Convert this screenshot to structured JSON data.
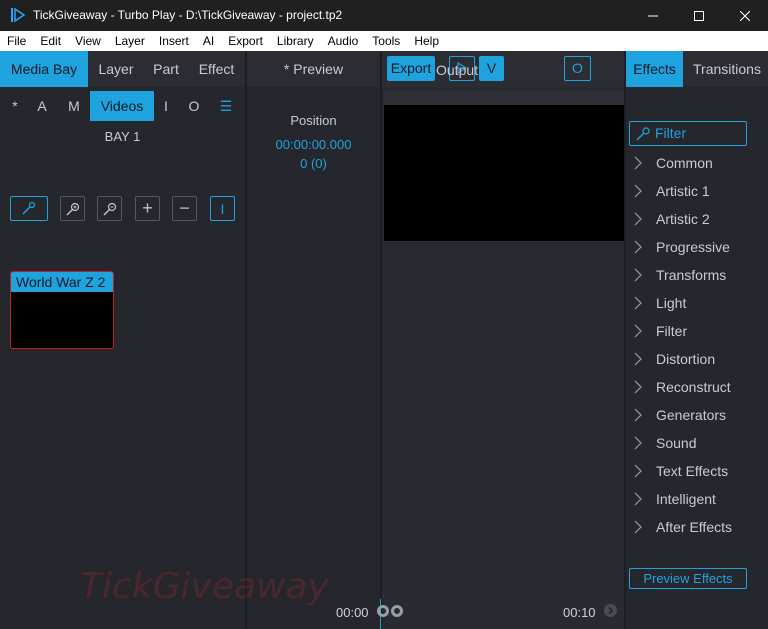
{
  "window": {
    "title": "TickGiveaway - Turbo Play - D:\\TickGiveaway - project.tp2"
  },
  "menu": [
    "File",
    "Edit",
    "View",
    "Layer",
    "Insert",
    "AI",
    "Export",
    "Library",
    "Audio",
    "Tools",
    "Help"
  ],
  "left_panel": {
    "tabs": [
      "Media Bay",
      "Layer",
      "Part",
      "Effect"
    ],
    "active_tab": "Media Bay",
    "subtabs": [
      "*",
      "A",
      "M",
      "Videos",
      "I",
      "O",
      "☰"
    ],
    "active_subtab": "Videos",
    "bay_label": "BAY 1",
    "clips": [
      {
        "title": "World War Z 2"
      }
    ],
    "tools": [
      "zoom-in-tool",
      "zoom-plus-tool",
      "zoom-minus-tool",
      "+",
      "−",
      "I"
    ]
  },
  "preview_panel": {
    "tab_label": "*  Preview",
    "position_label": "Position",
    "position_time": "00:00:00.000",
    "position_frame": "0 (0)"
  },
  "output_panel": {
    "export_label": "Export",
    "output_label": "Output",
    "v_label": "V",
    "o_label": "O",
    "timeline_start": "00:00",
    "timeline_end": "00:10"
  },
  "effects_panel": {
    "tabs": [
      "Effects",
      "Transitions"
    ],
    "active_tab": "Effects",
    "filter_label": "Filter",
    "categories": [
      "Common",
      "Artistic 1",
      "Artistic 2",
      "Progressive",
      "Transforms",
      "Light",
      "Filter",
      "Distortion",
      "Reconstruct",
      "Generators",
      "Sound",
      "Text Effects",
      "Intelligent",
      "After Effects"
    ],
    "preview_button": "Preview Effects"
  },
  "watermark": "TickGiveaway",
  "colors": {
    "accent": "#1fa3df",
    "panel_bg": "#26272d",
    "clip_border": "#c21c1c"
  }
}
